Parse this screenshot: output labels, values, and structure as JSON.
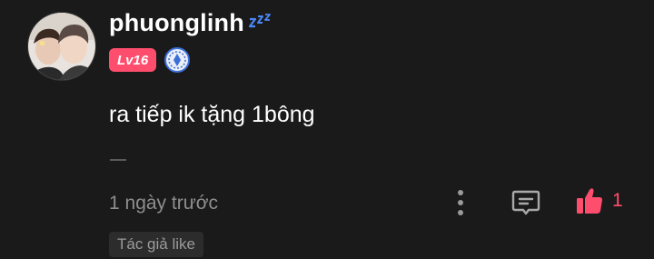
{
  "comment": {
    "username": "phuonglinh",
    "status_icon": "sleeping-zzz-icon",
    "level": "Lv16",
    "text": "ra tiếp ik tặng 1bông",
    "timestamp": "1 ngày trước",
    "like_count": "1",
    "author_tag": "Tác giả like"
  },
  "colors": {
    "background": "#1a1a1a",
    "accent_pink": "#ff4d6d",
    "secondary_text": "#8e8e8e",
    "zzz_blue": "#4a86f5",
    "rank_blue": "#3b6fd8"
  },
  "icons": {
    "more": "more-vertical-icon",
    "reply": "reply-comment-icon",
    "like": "thumbs-up-icon",
    "rank": "rank-badge-icon"
  }
}
